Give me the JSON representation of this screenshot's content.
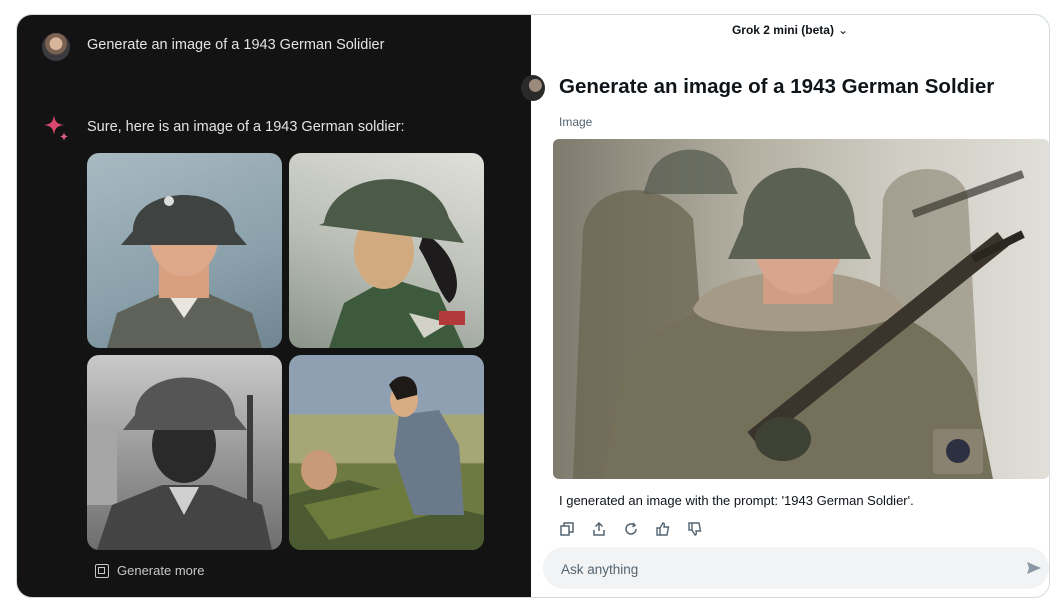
{
  "left_panel": {
    "user_prompt": "Generate an image of a 1943 German Solidier",
    "assistant_reply": "Sure, here is an image of a 1943 German soldier:",
    "generate_more_label": "Generate more",
    "icons": {
      "avatar": "user-avatar",
      "spark": "sparkle-icon",
      "generate_more": "images-icon"
    },
    "accent_colors": {
      "background": "#131314",
      "spark": "#d9486e"
    }
  },
  "right_panel": {
    "model_selector": "Grok 2 mini (beta)",
    "model_selector_icon": "chevron-down-icon",
    "prompt_title": "Generate an image of a 1943 German Soldier",
    "section_label": "Image",
    "caption": "I generated an image with the prompt: '1943 German Soldier'.",
    "action_icons": [
      "copy-icon",
      "share-icon",
      "regenerate-icon",
      "thumbs-up-icon",
      "thumbs-down-icon"
    ],
    "input_placeholder": "Ask anything",
    "send_icon": "send-icon"
  }
}
